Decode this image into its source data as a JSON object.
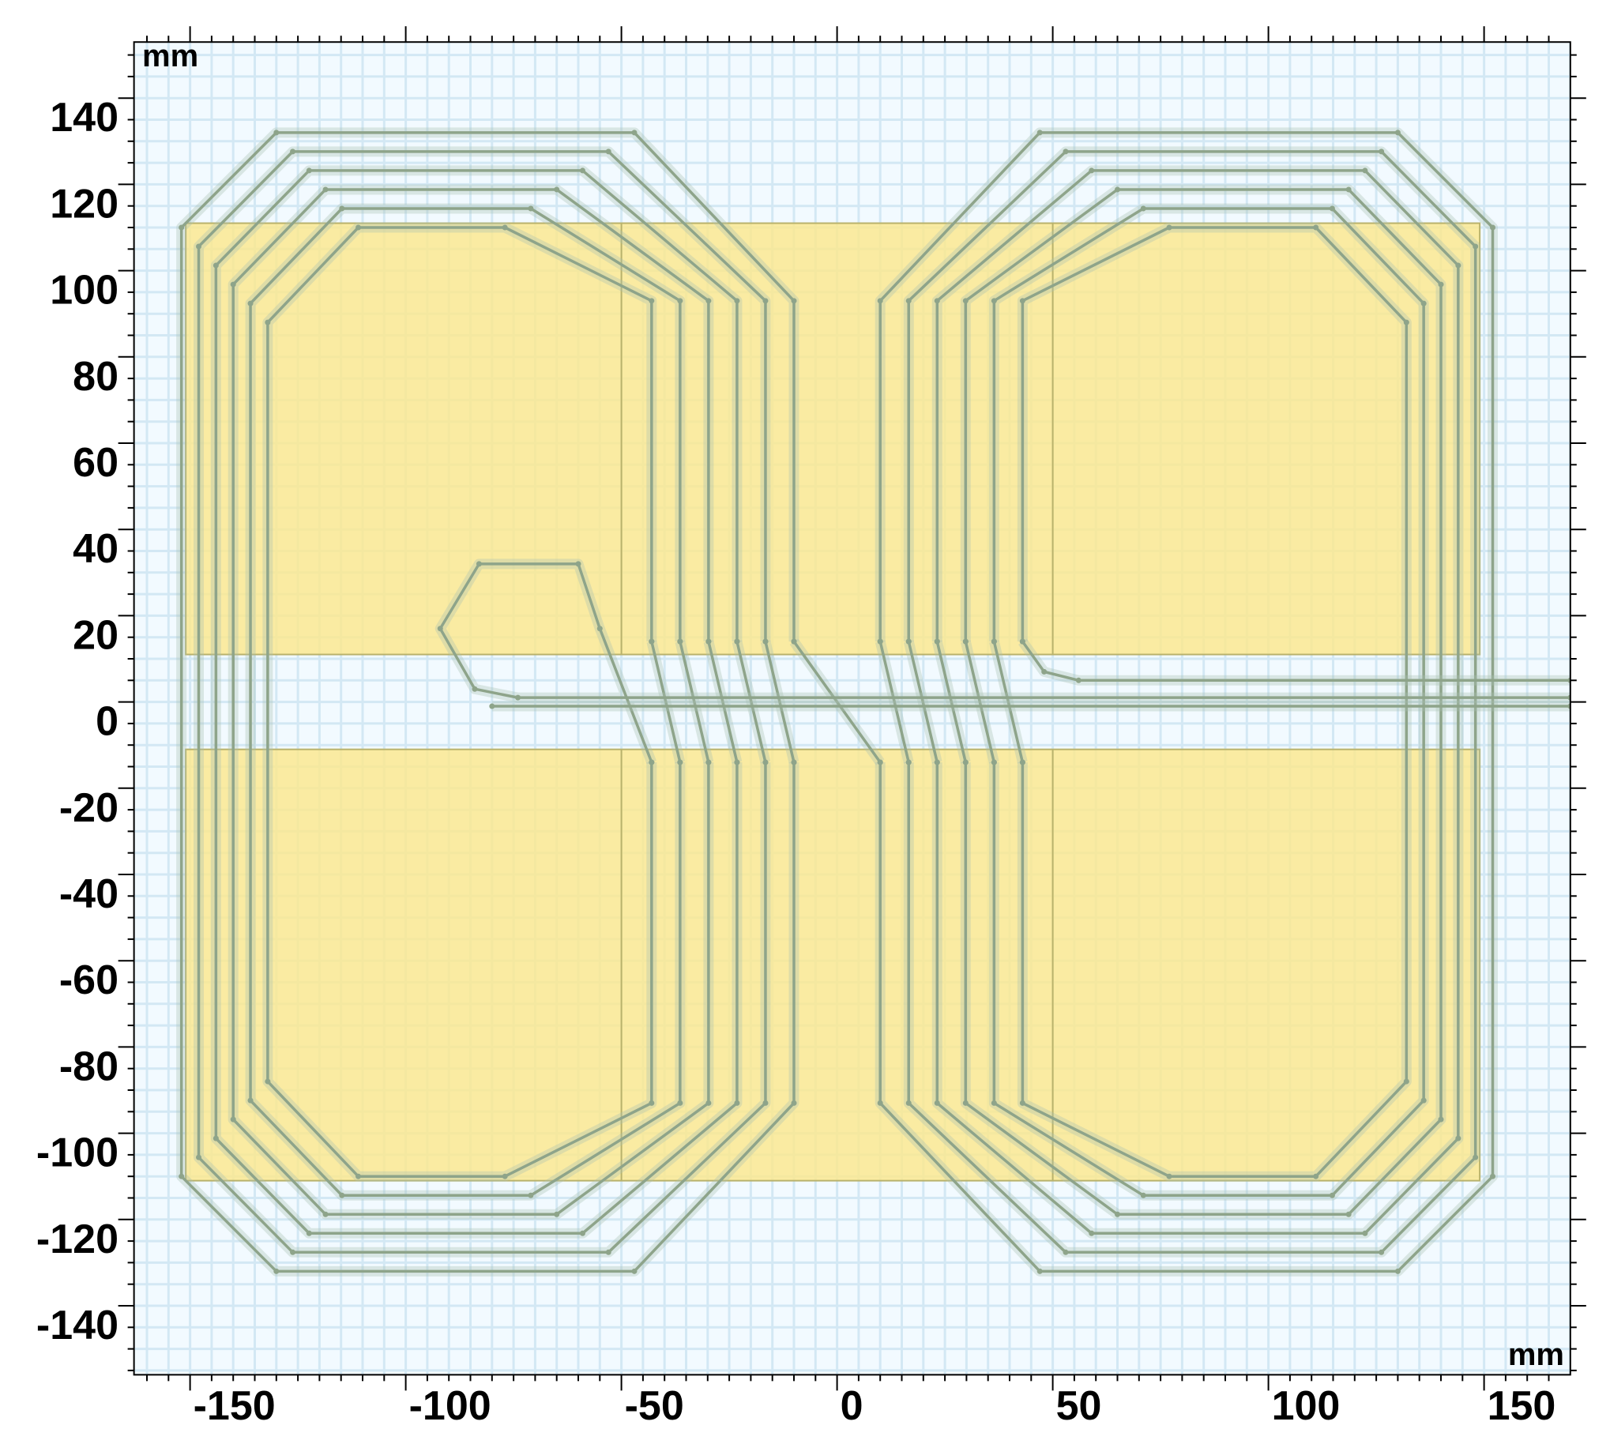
{
  "axes": {
    "x_unit_label": "mm",
    "y_unit_label": "mm",
    "x_ticks": [
      "-150",
      "-100",
      "-50",
      "0",
      "50",
      "100",
      "150"
    ],
    "y_ticks": [
      "140",
      "120",
      "100",
      "80",
      "60",
      "40",
      "20",
      "0",
      "-20",
      "-40",
      "-60",
      "-80",
      "-100",
      "-120",
      "-140"
    ],
    "xlim": [
      -163,
      170
    ],
    "ylim": [
      -156,
      153
    ],
    "grid_step": 5
  },
  "geometry": {
    "coils": 2,
    "turns_per_coil": 6
  },
  "colors": {
    "background": "#f2faff",
    "grid": "#d3e8f4",
    "yellow": "#fbe88e",
    "yellow_edge": "#b9b26c",
    "coil": "#8ea48a",
    "coil_halo": "#a9c1b3"
  }
}
